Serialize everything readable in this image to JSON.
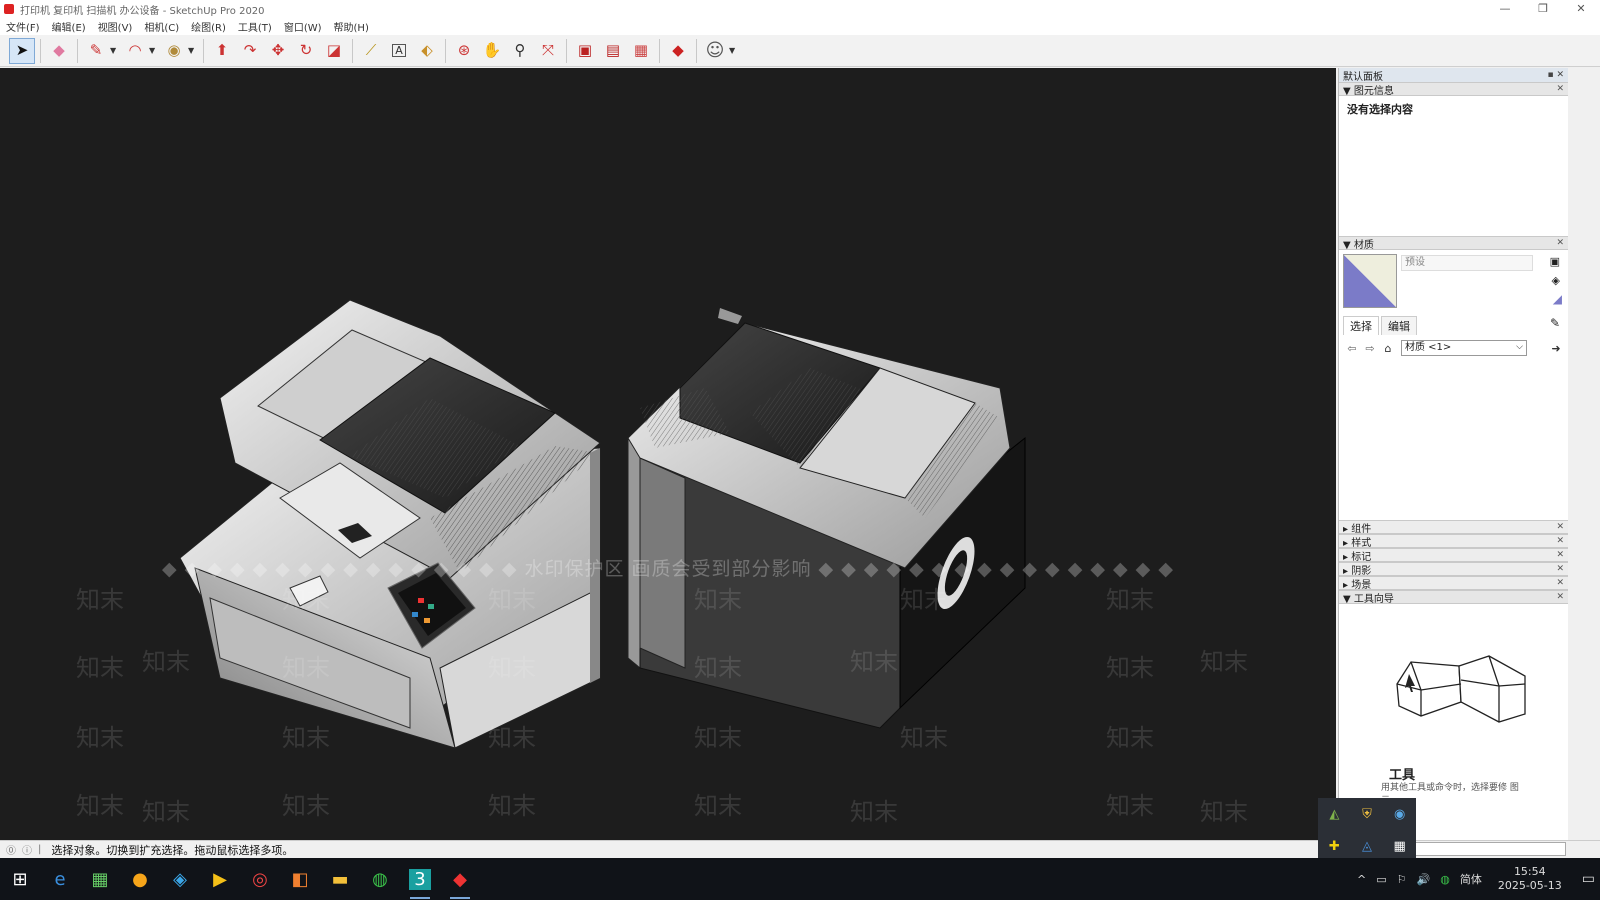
{
  "window": {
    "title": "打印机 复印机 扫描机 办公设备 - SketchUp Pro 2020",
    "min": "—",
    "restore": "❐",
    "close": "✕"
  },
  "menu": [
    "文件(F)",
    "编辑(E)",
    "视图(V)",
    "相机(C)",
    "绘图(R)",
    "工具(T)",
    "窗口(W)",
    "帮助(H)"
  ],
  "toolbar": {
    "tools": [
      {
        "name": "select",
        "glyph": "➤",
        "active": true
      },
      {
        "name": "eraser",
        "glyph": "◆"
      },
      {
        "name": "line",
        "glyph": "✎"
      },
      {
        "name": "arc",
        "glyph": "◠"
      },
      {
        "name": "circle",
        "glyph": "◉"
      },
      {
        "name": "push-pull",
        "glyph": "⬆"
      },
      {
        "name": "follow-me",
        "glyph": "↷"
      },
      {
        "name": "move",
        "glyph": "✥"
      },
      {
        "name": "rotate",
        "glyph": "↻"
      },
      {
        "name": "scale",
        "glyph": "◪"
      },
      {
        "name": "tape-measure",
        "glyph": "⟋"
      },
      {
        "name": "text",
        "glyph": "A"
      },
      {
        "name": "paint-bucket",
        "glyph": "⬖"
      },
      {
        "name": "orbit",
        "glyph": "⊛"
      },
      {
        "name": "pan",
        "glyph": "✋"
      },
      {
        "name": "zoom",
        "glyph": "⚲"
      },
      {
        "name": "zoom-extents",
        "glyph": "⤧"
      },
      {
        "name": "warehouse",
        "glyph": "▣"
      },
      {
        "name": "extension-warehouse",
        "glyph": "▤"
      },
      {
        "name": "send-to-layout",
        "glyph": "▦"
      },
      {
        "name": "extension-manager",
        "glyph": "◆"
      },
      {
        "name": "account",
        "glyph": "☺"
      }
    ]
  },
  "watermark": {
    "banner": "◆ ◆ ◆ ◆ ◆ ◆ ◆ ◆ ◆ ◆ ◆ ◆ ◆ ◆ ◆ ◆ 水印保护区   画质会受到部分影响 ◆ ◆ ◆ ◆ ◆ ◆ ◆ ◆ ◆ ◆ ◆ ◆ ◆ ◆ ◆ ◆",
    "text": "知末"
  },
  "panel": {
    "title": "默认面板",
    "entity_info": {
      "title": "图元信息",
      "content": "没有选择内容"
    },
    "materials": {
      "title": "材质",
      "name_placeholder": "预设",
      "tab_select": "选择",
      "tab_edit": "编辑",
      "library": "材质 <1>"
    },
    "collapsed": [
      "组件",
      "样式",
      "标记",
      "阴影",
      "场景"
    ],
    "instructor": {
      "title": "工具向导",
      "tool_title": "工具",
      "tool_desc": "用其他工具或命令时，选择要修 图元。"
    }
  },
  "status": {
    "text": "选择对象。切换到扩充选择。拖动鼠标选择多项。"
  },
  "taskbar": {
    "apps": [
      "⊞",
      "e",
      "▦",
      "●",
      "◈",
      "▶",
      "◎",
      "◧",
      "▬",
      "◍",
      "3",
      "◆"
    ],
    "tray": [
      "^",
      "▭",
      "⚐",
      "🔊",
      "◍",
      "简体"
    ],
    "time": "15:54",
    "date": "2025-05-13"
  },
  "popup_icons": [
    "◭",
    "⛨",
    "◉",
    "✚",
    "◬",
    "▦"
  ]
}
